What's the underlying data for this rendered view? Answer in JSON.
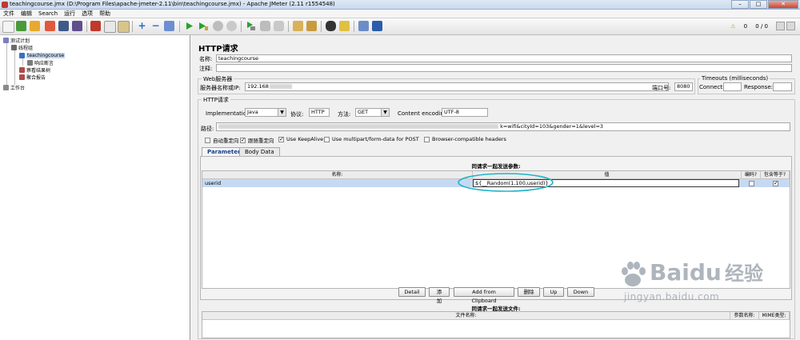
{
  "window": {
    "title": "teachingcourse.jmx (D:\\Program Files\\apache-jmeter-2.11\\bin\\teachingcourse.jmx) - Apache JMeter (2.11 r1554548)",
    "minimize": "–",
    "maximize": "□",
    "close": "✕"
  },
  "menu": [
    "文件",
    "编辑",
    "Search",
    "运行",
    "选项",
    "帮助"
  ],
  "toolbar": {
    "warnings": "0",
    "active_threads": "0 / 0",
    "warning_glyph": "⚠"
  },
  "tree": {
    "nodes": [
      {
        "label": "测试计划",
        "icon": "test-plan-icon"
      },
      {
        "label": "线程组",
        "icon": "thread-group-icon"
      },
      {
        "label": "teachingcourse",
        "icon": "http-sampler-icon"
      },
      {
        "label": "响应断言",
        "icon": "assertion-icon"
      },
      {
        "label": "察看结果树",
        "icon": "listener-icon"
      },
      {
        "label": "聚合报告",
        "icon": "listener-icon"
      },
      {
        "label": "工作台",
        "icon": "workbench-icon"
      }
    ]
  },
  "panel": {
    "title": "HTTP请求",
    "name_label": "名称:",
    "name_value": "teachingcourse",
    "comment_label": "注释:",
    "comment_value": "",
    "web_server_title": "Web服务器",
    "server_label": "服务器名称或IP:",
    "server_value": "192.168",
    "port_label": "端口号:",
    "port_value": "8080",
    "timeouts_title": "Timeouts (milliseconds)",
    "connect_label": "Connect:",
    "connect_value": "",
    "response_label": "Response:",
    "response_value": "",
    "http_req_title": "HTTP请求",
    "impl_label": "Implementation:",
    "impl_value": "Java",
    "protocol_label": "协议:",
    "protocol_value": "HTTP",
    "method_label": "方法:",
    "method_value": "GET",
    "encoding_label": "Content encoding:",
    "encoding_value": "UTF-8",
    "path_label": "路径:",
    "path_value": "k=wifi&cityId=103&gender=1&level=3",
    "checks": [
      {
        "label": "自动重定向",
        "checked": false
      },
      {
        "label": "跟随重定向",
        "checked": true
      },
      {
        "label": "Use KeepAlive",
        "checked": true
      },
      {
        "label": "Use multipart/form-data for POST",
        "checked": false
      },
      {
        "label": "Browser-compatible headers",
        "checked": false
      }
    ],
    "tabs": [
      "Parameters",
      "Body Data"
    ],
    "params_title": "同请求一起发送参数:",
    "params_cols": [
      "名称:",
      "值",
      "编码?",
      "包含等于?"
    ],
    "params_rows": [
      {
        "name": "userid",
        "value": "${__Random(1,100,userid)}",
        "encode": false,
        "include_equals": true
      }
    ],
    "buttons": [
      "Detail",
      "添加",
      "Add from Clipboard",
      "删除",
      "Up",
      "Down"
    ],
    "files_title": "同请求一起发送文件:",
    "files_cols": [
      "文件名称:",
      "参数名称:",
      "MIME类型:"
    ],
    "check_mark": "✓"
  },
  "watermark": {
    "brand": "Baidu",
    "brand_cn": "经验",
    "url": "jingyan.baidu.com"
  },
  "colors": {
    "highlight_ellipse": "#22b4c8",
    "selected_row": "#c7d9f2",
    "link_blue": "#1a3d8c"
  }
}
